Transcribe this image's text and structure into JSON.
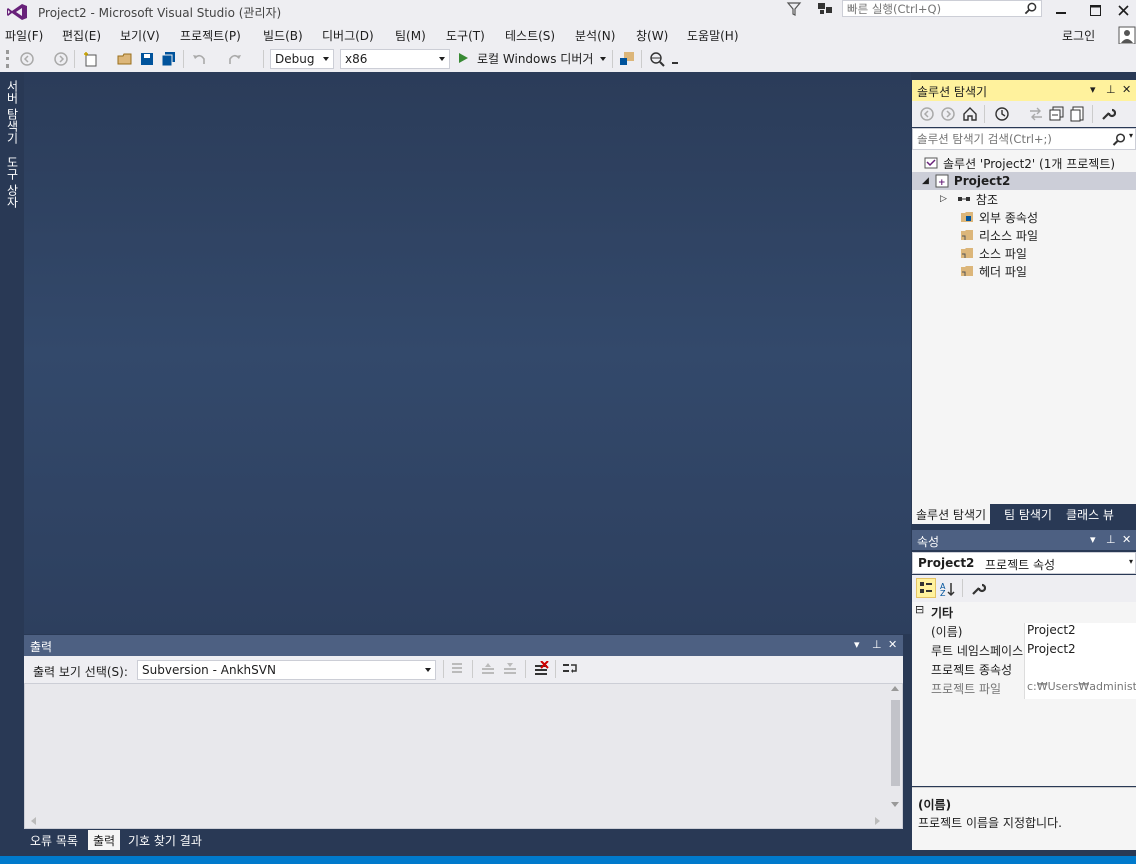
{
  "titlebar": {
    "title": "Project2 - Microsoft Visual Studio (관리자)",
    "quick_launch_placeholder": "빠른 실행(Ctrl+Q)"
  },
  "menu": {
    "items": [
      "파일(F)",
      "편집(E)",
      "보기(V)",
      "프로젝트(P)",
      "빌드(B)",
      "디버그(D)",
      "팀(M)",
      "도구(T)",
      "테스트(S)",
      "분석(N)",
      "창(W)",
      "도움말(H)"
    ],
    "login": "로그인"
  },
  "toolbar": {
    "configuration": "Debug",
    "platform": "x86",
    "run_label": "로컬 Windows 디버거"
  },
  "left_strip": {
    "server_explorer": "서버 탐색기",
    "toolbox": "도구 상자"
  },
  "output": {
    "title": "출력",
    "source_label": "출력 보기 선택(S):",
    "source_value": "Subversion - AnkhSVN"
  },
  "bottom_tabs": [
    "오류 목록",
    "출력",
    "기호 찾기 결과"
  ],
  "solution_explorer": {
    "title": "솔루션 탐색기",
    "search_placeholder": "솔루션 탐색기 검색(Ctrl+;)",
    "tree": {
      "solution": "솔루션 'Project2' (1개 프로젝트)",
      "project": "Project2",
      "references": "참조",
      "external_deps": "외부 종속성",
      "resource_files": "리소스 파일",
      "source_files": "소스 파일",
      "header_files": "헤더 파일"
    },
    "tabs": [
      "솔루션 탐색기",
      "팀 탐색기",
      "클래스 뷰"
    ]
  },
  "properties": {
    "title": "속성",
    "object": "Project2",
    "object_suffix": "프로젝트 속성",
    "category": "기타",
    "rows": [
      {
        "name": "(이름)",
        "value": "Project2"
      },
      {
        "name": "루트 네임스페이스",
        "value": "Project2"
      },
      {
        "name": "프로젝트 종속성",
        "value": ""
      },
      {
        "name": "프로젝트 파일",
        "value": "c:₩Users₩administra"
      }
    ],
    "desc_title": "(이름)",
    "desc_text": "프로젝트 이름을 지정합니다."
  },
  "colors": {
    "accent": "#007acc",
    "panel_active": "#fff29d",
    "panel_inactive": "#4d6082",
    "background": "#293955"
  }
}
